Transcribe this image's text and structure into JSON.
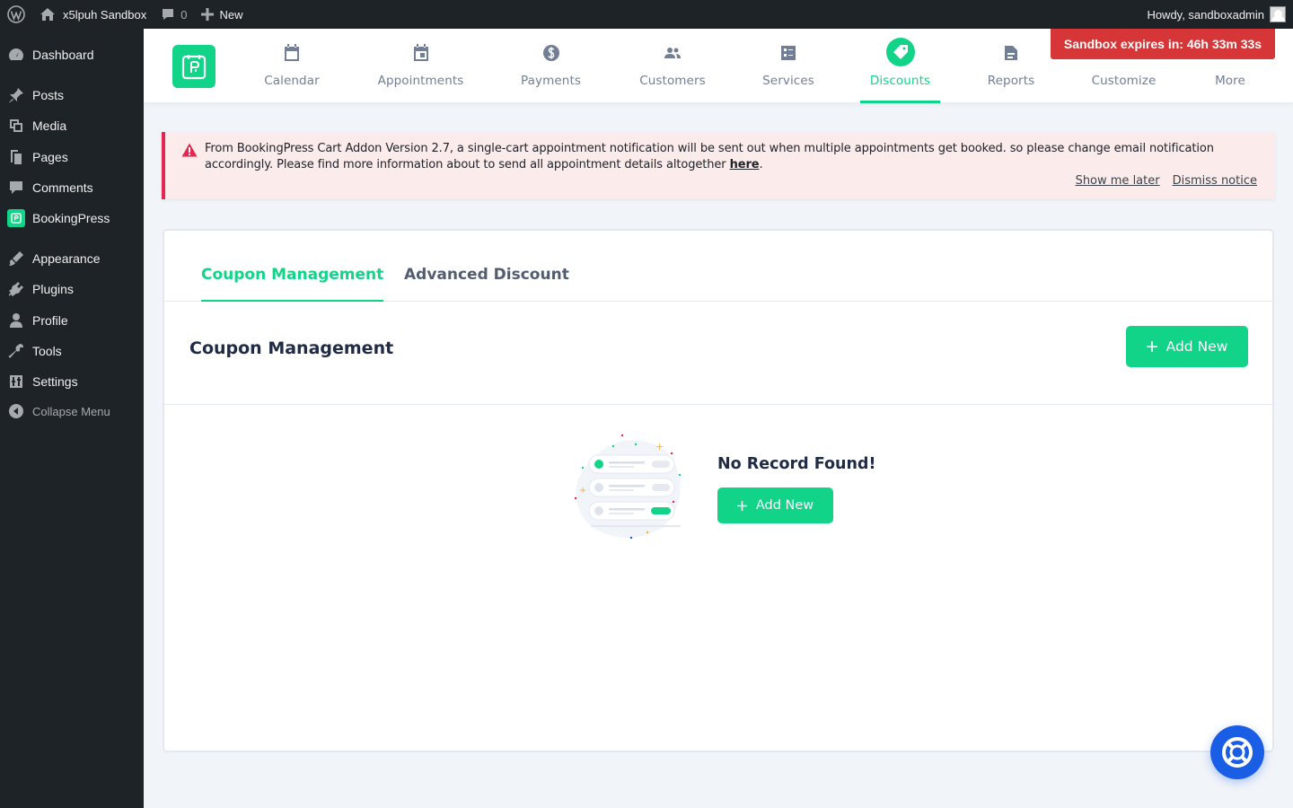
{
  "adminbar": {
    "site_name": "x5lpuh Sandbox",
    "comments_count": "0",
    "new_label": "New",
    "howdy": "Howdy, sandboxadmin"
  },
  "sidebar": {
    "items": [
      {
        "label": "Dashboard",
        "icon": "dashboard-icon"
      },
      {
        "label": "Posts",
        "icon": "pin-icon"
      },
      {
        "label": "Media",
        "icon": "media-icon"
      },
      {
        "label": "Pages",
        "icon": "pages-icon"
      },
      {
        "label": "Comments",
        "icon": "comments-icon"
      },
      {
        "label": "BookingPress",
        "icon": "bookingpress-icon"
      },
      {
        "label": "Appearance",
        "icon": "appearance-icon"
      },
      {
        "label": "Plugins",
        "icon": "plugins-icon"
      },
      {
        "label": "Profile",
        "icon": "profile-icon"
      },
      {
        "label": "Tools",
        "icon": "tools-icon"
      },
      {
        "label": "Settings",
        "icon": "settings-icon"
      }
    ],
    "collapse_label": "Collapse Menu"
  },
  "topnav": {
    "items": [
      {
        "label": "Calendar",
        "icon": "calendar-icon"
      },
      {
        "label": "Appointments",
        "icon": "appointments-icon"
      },
      {
        "label": "Payments",
        "icon": "payments-icon"
      },
      {
        "label": "Customers",
        "icon": "customers-icon"
      },
      {
        "label": "Services",
        "icon": "services-icon"
      },
      {
        "label": "Discounts",
        "icon": "tag-icon",
        "active": true
      },
      {
        "label": "Reports",
        "icon": "reports-icon"
      },
      {
        "label": "Customize",
        "icon": "customize-icon"
      },
      {
        "label": "More",
        "icon": "more-icon"
      }
    ],
    "sandbox_timer": "Sandbox expires in: 46h 33m 33s"
  },
  "notice": {
    "text": "From BookingPress Cart Addon Version 2.7, a single-cart appointment notification will be sent out when multiple appointments get booked. so please change email notification accordingly. Please find more information about to send all appointment details altogether ",
    "link_text": "here",
    "text_end": ".",
    "show_later": "Show me later",
    "dismiss": "Dismiss notice"
  },
  "tabs": [
    {
      "label": "Coupon Management",
      "active": true
    },
    {
      "label": "Advanced Discount",
      "active": false
    }
  ],
  "section": {
    "title": "Coupon Management",
    "add_new_label": "Add New"
  },
  "empty_state": {
    "title": "No Record Found!",
    "add_new_label": "Add New"
  },
  "colors": {
    "accent": "#12d488",
    "admin_bg": "#1d2327",
    "notice_border": "#e32752",
    "sandbox_badge": "#d63638",
    "help_button": "#1a5ee6"
  }
}
